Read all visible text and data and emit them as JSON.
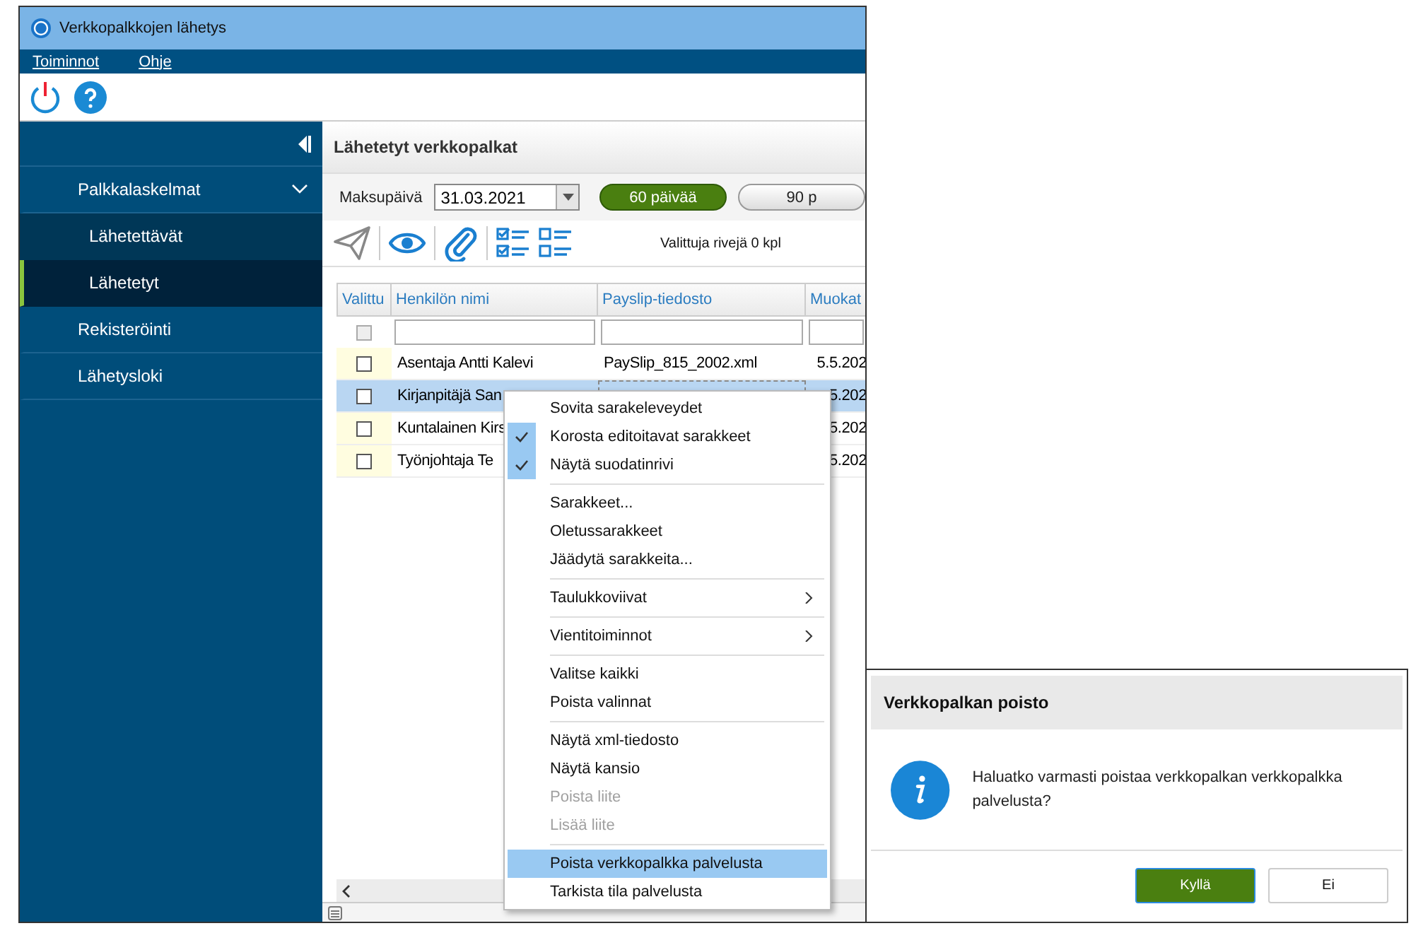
{
  "window": {
    "title": "Verkkopalkkojen lähetys"
  },
  "menu_bar": [
    "Toiminnot",
    "Ohje"
  ],
  "sidebar": {
    "items": [
      {
        "label": "Palkkalaskelmat",
        "expanded": true,
        "selected": false,
        "children": [
          {
            "label": "Lähetettävät",
            "selected": false
          },
          {
            "label": "Lähetetyt",
            "selected": true
          }
        ]
      },
      {
        "label": "Rekisteröinti",
        "selected": false
      },
      {
        "label": "Lähetysloki",
        "selected": false
      }
    ]
  },
  "content": {
    "title": "Lähetetyt verkkopalkat",
    "date_label": "Maksupäivä",
    "date_value": "31.03.2021",
    "ranges": [
      {
        "label": "60 päivää",
        "selected": true
      },
      {
        "label": "90 p",
        "selected": false
      }
    ],
    "selected_count": "Valittuja rivejä 0 kpl"
  },
  "table": {
    "columns": [
      "Valittu",
      "Henkilön nimi",
      "Payslip-tiedosto",
      "Muokat"
    ],
    "select_all": {
      "checked": false,
      "disabled": true
    },
    "rows": [
      {
        "checked": false,
        "selected": false,
        "name": "Asentaja Antti Kalevi",
        "payslip": "PaySlip_815_2002.xml",
        "modified": "5.5.202"
      },
      {
        "checked": false,
        "selected": true,
        "name": "Kirjanpitäjä San",
        "modified": "5.202"
      },
      {
        "checked": false,
        "selected": false,
        "name": "Kuntalainen Kirs",
        "modified": "5.202"
      },
      {
        "checked": false,
        "selected": false,
        "name": "Työnjohtaja Te",
        "modified": "5.202"
      }
    ]
  },
  "context_menu": [
    {
      "kind": "item",
      "label": "Sovita sarakeleveydet",
      "checked": false,
      "disabled": false,
      "selected": false
    },
    {
      "kind": "item",
      "label": "Korosta editoitavat sarakkeet",
      "checked": true,
      "disabled": false,
      "selected": false
    },
    {
      "kind": "item",
      "label": "Näytä suodatinrivi",
      "checked": true,
      "disabled": false,
      "selected": false
    },
    {
      "kind": "separator"
    },
    {
      "kind": "item",
      "label": "Sarakkeet...",
      "checked": false,
      "disabled": false,
      "selected": false
    },
    {
      "kind": "item",
      "label": "Oletussarakkeet",
      "checked": false,
      "disabled": false,
      "selected": false
    },
    {
      "kind": "item",
      "label": "Jäädytä sarakkeita...",
      "checked": false,
      "disabled": false,
      "selected": false
    },
    {
      "kind": "separator"
    },
    {
      "kind": "submenu",
      "label": "Taulukkoviivat",
      "checked": false,
      "disabled": false,
      "selected": false
    },
    {
      "kind": "separator"
    },
    {
      "kind": "submenu",
      "label": "Vientitoiminnot",
      "checked": false,
      "disabled": false,
      "selected": false
    },
    {
      "kind": "separator"
    },
    {
      "kind": "item",
      "label": "Valitse kaikki",
      "checked": false,
      "disabled": false,
      "selected": false
    },
    {
      "kind": "item",
      "label": "Poista valinnat",
      "checked": false,
      "disabled": false,
      "selected": false
    },
    {
      "kind": "separator"
    },
    {
      "kind": "item",
      "label": "Näytä xml-tiedosto",
      "checked": false,
      "disabled": false,
      "selected": false
    },
    {
      "kind": "item",
      "label": "Näytä kansio",
      "checked": false,
      "disabled": false,
      "selected": false
    },
    {
      "kind": "item",
      "label": "Poista liite",
      "checked": false,
      "disabled": true,
      "selected": false
    },
    {
      "kind": "item",
      "label": "Lisää liite",
      "checked": false,
      "disabled": true,
      "selected": false
    },
    {
      "kind": "separator"
    },
    {
      "kind": "item",
      "label": "Poista verkkopalkka palvelusta",
      "checked": false,
      "disabled": false,
      "selected": true
    },
    {
      "kind": "item",
      "label": "Tarkista tila palvelusta",
      "checked": false,
      "disabled": false,
      "selected": false
    }
  ],
  "dialog": {
    "title": "Verkkopalkan poisto",
    "message": "Haluatko varmasti poistaa verkkopalkan verkkopalkka palvelusta?",
    "buttons": [
      {
        "label": "Kyllä",
        "primary": true
      },
      {
        "label": "Ei",
        "primary": false
      }
    ]
  }
}
